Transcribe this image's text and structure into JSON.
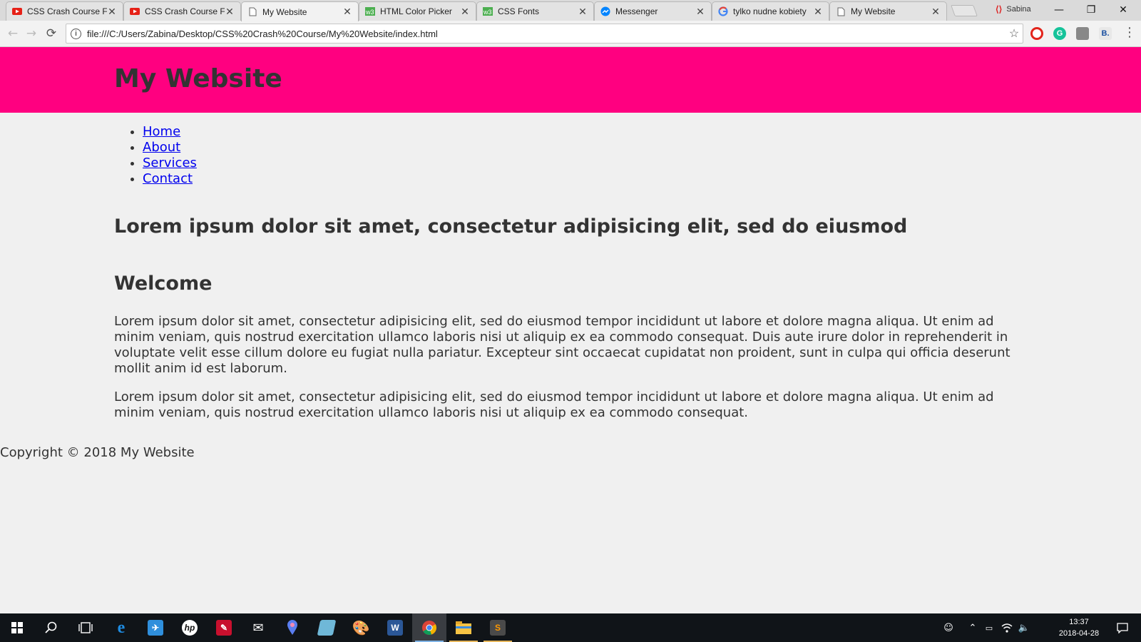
{
  "browser": {
    "tabs": [
      {
        "title": "CSS Crash Course For Absolute Beginners - YouTube",
        "icon": "youtube-icon",
        "active": false
      },
      {
        "title": "CSS Crash Course For Absolute Beginners - YouTube",
        "icon": "youtube-icon",
        "active": false
      },
      {
        "title": "My Website",
        "icon": "page-icon",
        "active": true
      },
      {
        "title": "HTML Color Picker",
        "icon": "w3schools-icon",
        "active": false
      },
      {
        "title": "CSS Fonts",
        "icon": "w3schools-icon",
        "active": false
      },
      {
        "title": "Messenger",
        "icon": "messenger-icon",
        "active": false
      },
      {
        "title": "tylko nudne kobiety",
        "icon": "google-icon",
        "active": false
      },
      {
        "title": "My Website",
        "icon": "page-icon",
        "active": false
      }
    ],
    "close_glyph": "✕",
    "profile_name": "Sabina",
    "url": "file:///C:/Users/Zabina/Desktop/CSS%20Crash%20Course/My%20Website/index.html",
    "info_glyph": "i",
    "window_controls": {
      "minimize": "—",
      "restore": "❐",
      "close": "✕"
    }
  },
  "page": {
    "header_title": "My Website",
    "nav": [
      "Home",
      "About",
      "Services",
      "Contact"
    ],
    "showcase_heading": "Lorem ipsum dolor sit amet, consectetur adipisicing elit, sed do eiusmod",
    "welcome_heading": "Welcome",
    "paragraphs": [
      "Lorem ipsum dolor sit amet, consectetur adipisicing elit, sed do eiusmod tempor incididunt ut labore et dolore magna aliqua. Ut enim ad minim veniam, quis nostrud exercitation ullamco laboris nisi ut aliquip ex ea commodo consequat. Duis aute irure dolor in reprehenderit in voluptate velit esse cillum dolore eu fugiat nulla pariatur. Excepteur sint occaecat cupidatat non proident, sunt in culpa qui officia deserunt mollit anim id est laborum.",
      "Lorem ipsum dolor sit amet, consectetur adipisicing elit, sed do eiusmod tempor incididunt ut labore et dolore magna aliqua. Ut enim ad minim veniam, quis nostrud exercitation ullamco laboris nisi ut aliquip ex ea commodo consequat."
    ],
    "footer": "Copyright © 2018 My Website",
    "colors": {
      "header_bg": "#ff0080",
      "link": "#0000ee",
      "text": "#333333",
      "page_bg": "#f0f0f0"
    }
  },
  "taskbar": {
    "clock_time": "13:37",
    "clock_date": "2018-04-28"
  }
}
